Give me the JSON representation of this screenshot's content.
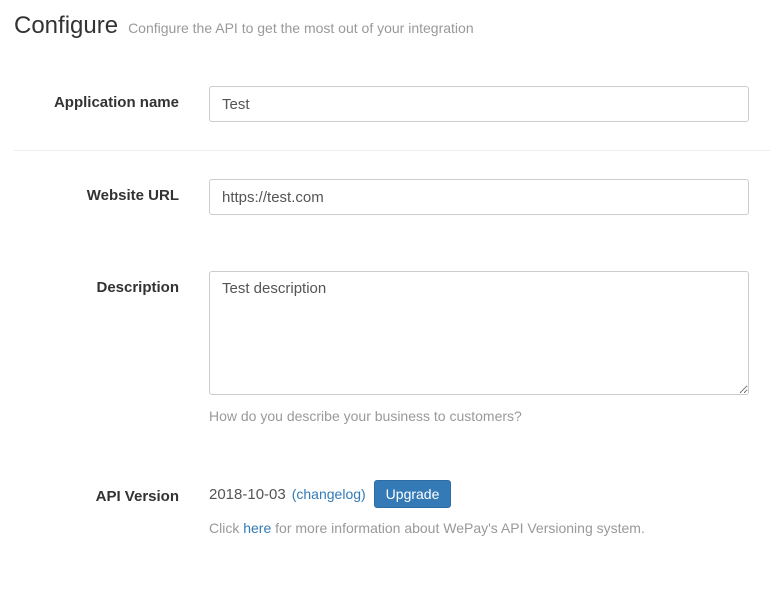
{
  "header": {
    "title": "Configure",
    "subtitle": "Configure the API to get the most out of your integration"
  },
  "fields": {
    "app_name": {
      "label": "Application name",
      "value": "Test"
    },
    "website_url": {
      "label": "Website URL",
      "value": "https://test.com"
    },
    "description": {
      "label": "Description",
      "value": "Test description",
      "help": "How do you describe your business to customers?"
    },
    "api_version": {
      "label": "API Version",
      "version": "2018-10-03",
      "changelog_label": "(changelog)",
      "upgrade_label": "Upgrade",
      "info_pre": "Click ",
      "info_link": "here",
      "info_post": " for more information about WePay's API Versioning system."
    }
  }
}
